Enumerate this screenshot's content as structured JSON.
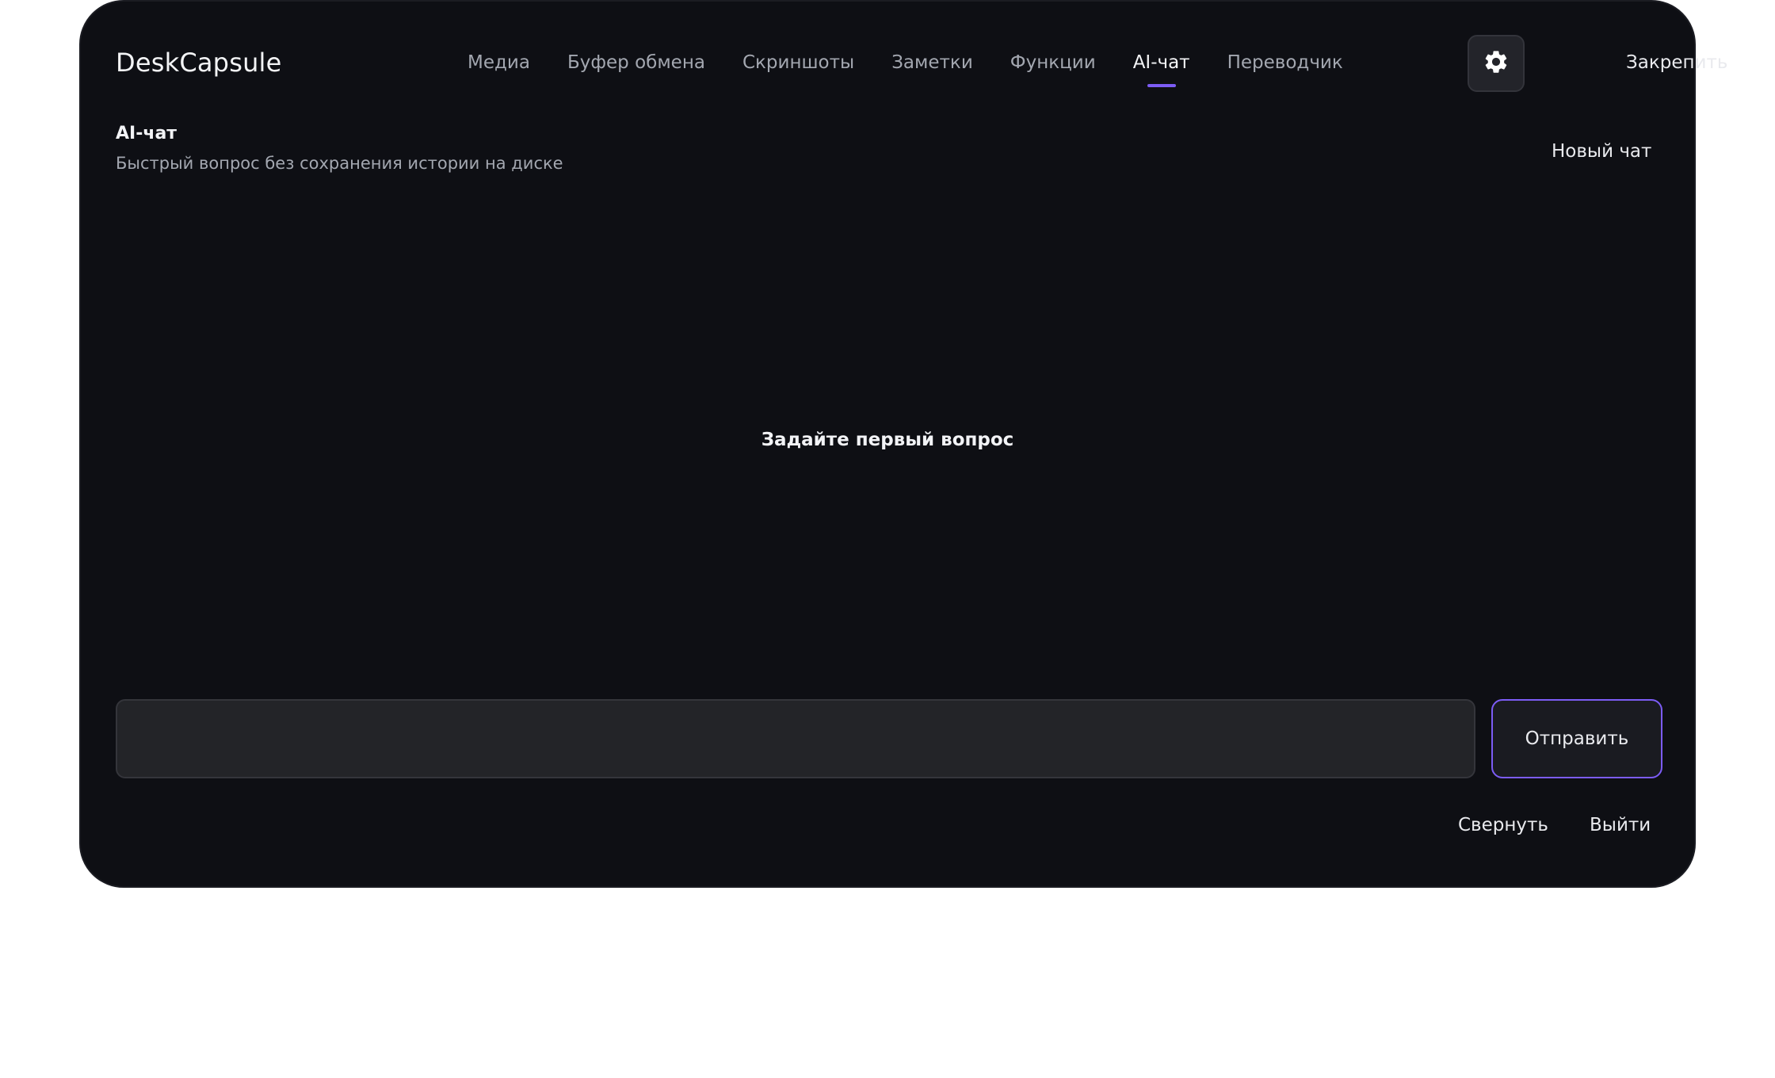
{
  "app": {
    "title": "DeskCapsule"
  },
  "nav": {
    "tabs": [
      {
        "label": "Медиа",
        "active": false
      },
      {
        "label": "Буфер обмена",
        "active": false
      },
      {
        "label": "Скриншоты",
        "active": false
      },
      {
        "label": "Заметки",
        "active": false
      },
      {
        "label": "Функции",
        "active": false
      },
      {
        "label": "AI-чат",
        "active": true
      },
      {
        "label": "Переводчик",
        "active": false
      }
    ],
    "settings_icon": "gear-icon",
    "pin_label": "Закрепить"
  },
  "page": {
    "title": "AI-чат",
    "subtitle": "Быстрый вопрос без сохранения истории на диске",
    "new_chat_label": "Новый чат",
    "empty_state": "Задайте первый вопрос"
  },
  "composer": {
    "value": "",
    "placeholder": "",
    "send_label": "Отправить"
  },
  "footer": {
    "collapse_label": "Свернуть",
    "exit_label": "Выйти"
  },
  "colors": {
    "background": "#0e0f14",
    "accent": "#7c5cf5",
    "text_primary": "#f2f3f6",
    "text_muted": "#a3a7b0"
  }
}
